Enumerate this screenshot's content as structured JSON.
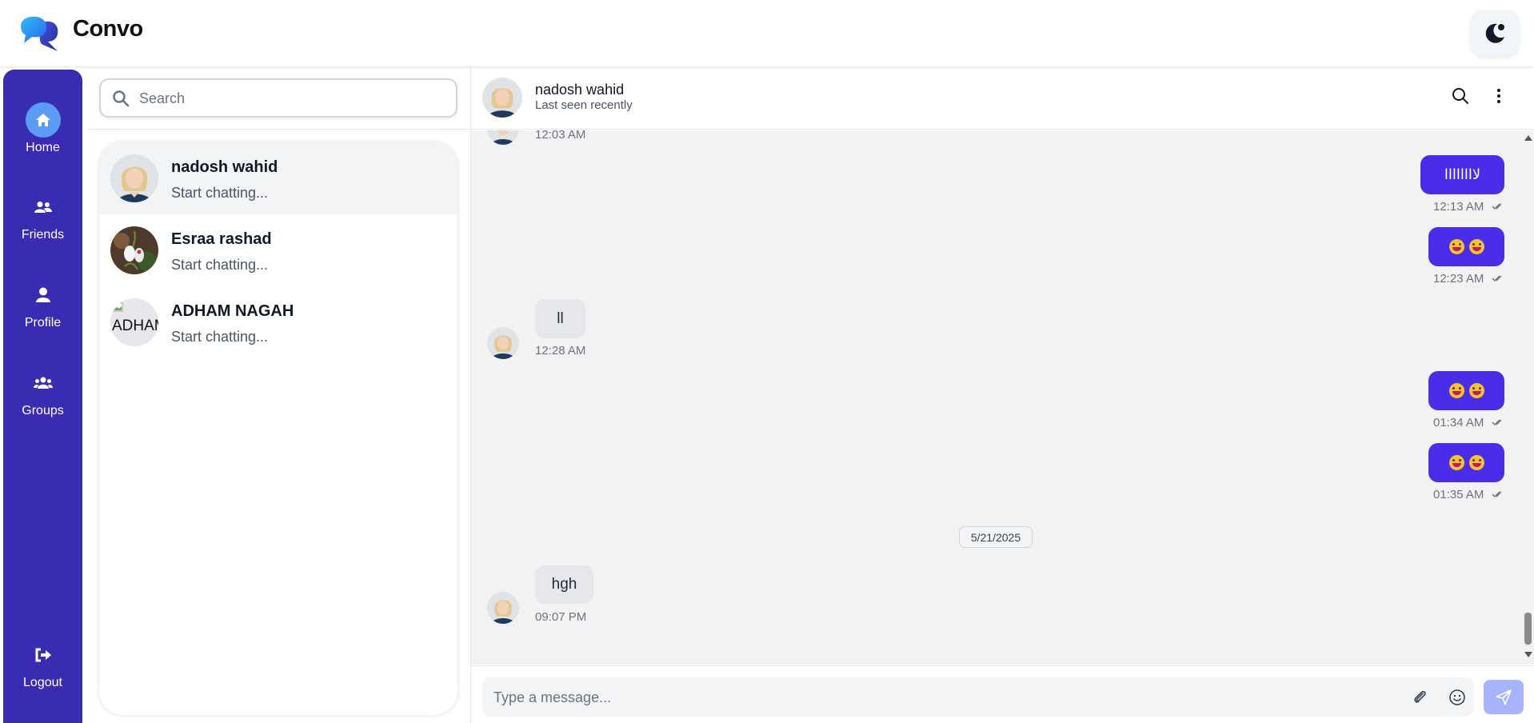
{
  "app": {
    "name": "Convo"
  },
  "sidebar": {
    "items": [
      {
        "label": "Home",
        "icon": "home-icon",
        "active": true
      },
      {
        "label": "Friends",
        "icon": "friends-icon"
      },
      {
        "label": "Profile",
        "icon": "user-icon"
      },
      {
        "label": "Groups",
        "icon": "groups-icon"
      }
    ],
    "logout_label": "Logout"
  },
  "search": {
    "placeholder": "Search"
  },
  "chats": [
    {
      "name": "nadosh wahid",
      "preview": "Start chatting...",
      "selected": true
    },
    {
      "name": "Esraa rashad",
      "preview": "Start chatting..."
    },
    {
      "name": "ADHAM NAGAH",
      "preview": "Start chatting...",
      "avatar_alt": "ADHAM NAGAH"
    }
  ],
  "conversation": {
    "contact_name": "nadosh wahid",
    "status": "Last seen recently",
    "messages": [
      {
        "direction": "in",
        "text": "",
        "time": "12:03 AM"
      },
      {
        "direction": "out",
        "text": "لاااااااا",
        "time": "12:13 AM"
      },
      {
        "direction": "out",
        "text": "😄😄",
        "time": "12:23 AM"
      },
      {
        "direction": "in",
        "text": "ll",
        "time": "12:28 AM"
      },
      {
        "direction": "out",
        "text": "😄😄",
        "time": "01:34 AM"
      },
      {
        "direction": "out",
        "text": "😄😄",
        "time": "01:35 AM"
      },
      {
        "direction": "in",
        "text": "hgh",
        "time": "09:07 PM"
      }
    ],
    "date_separator": "5/21/2025"
  },
  "composer": {
    "placeholder": "Type a message..."
  },
  "colors": {
    "sidebar": "#3a2bb3",
    "active_nav": "#5b9bf5",
    "outgoing_bubble": "#4a2de8",
    "incoming_bubble": "#e5e7eb",
    "send_button": "#a5b4fc"
  }
}
